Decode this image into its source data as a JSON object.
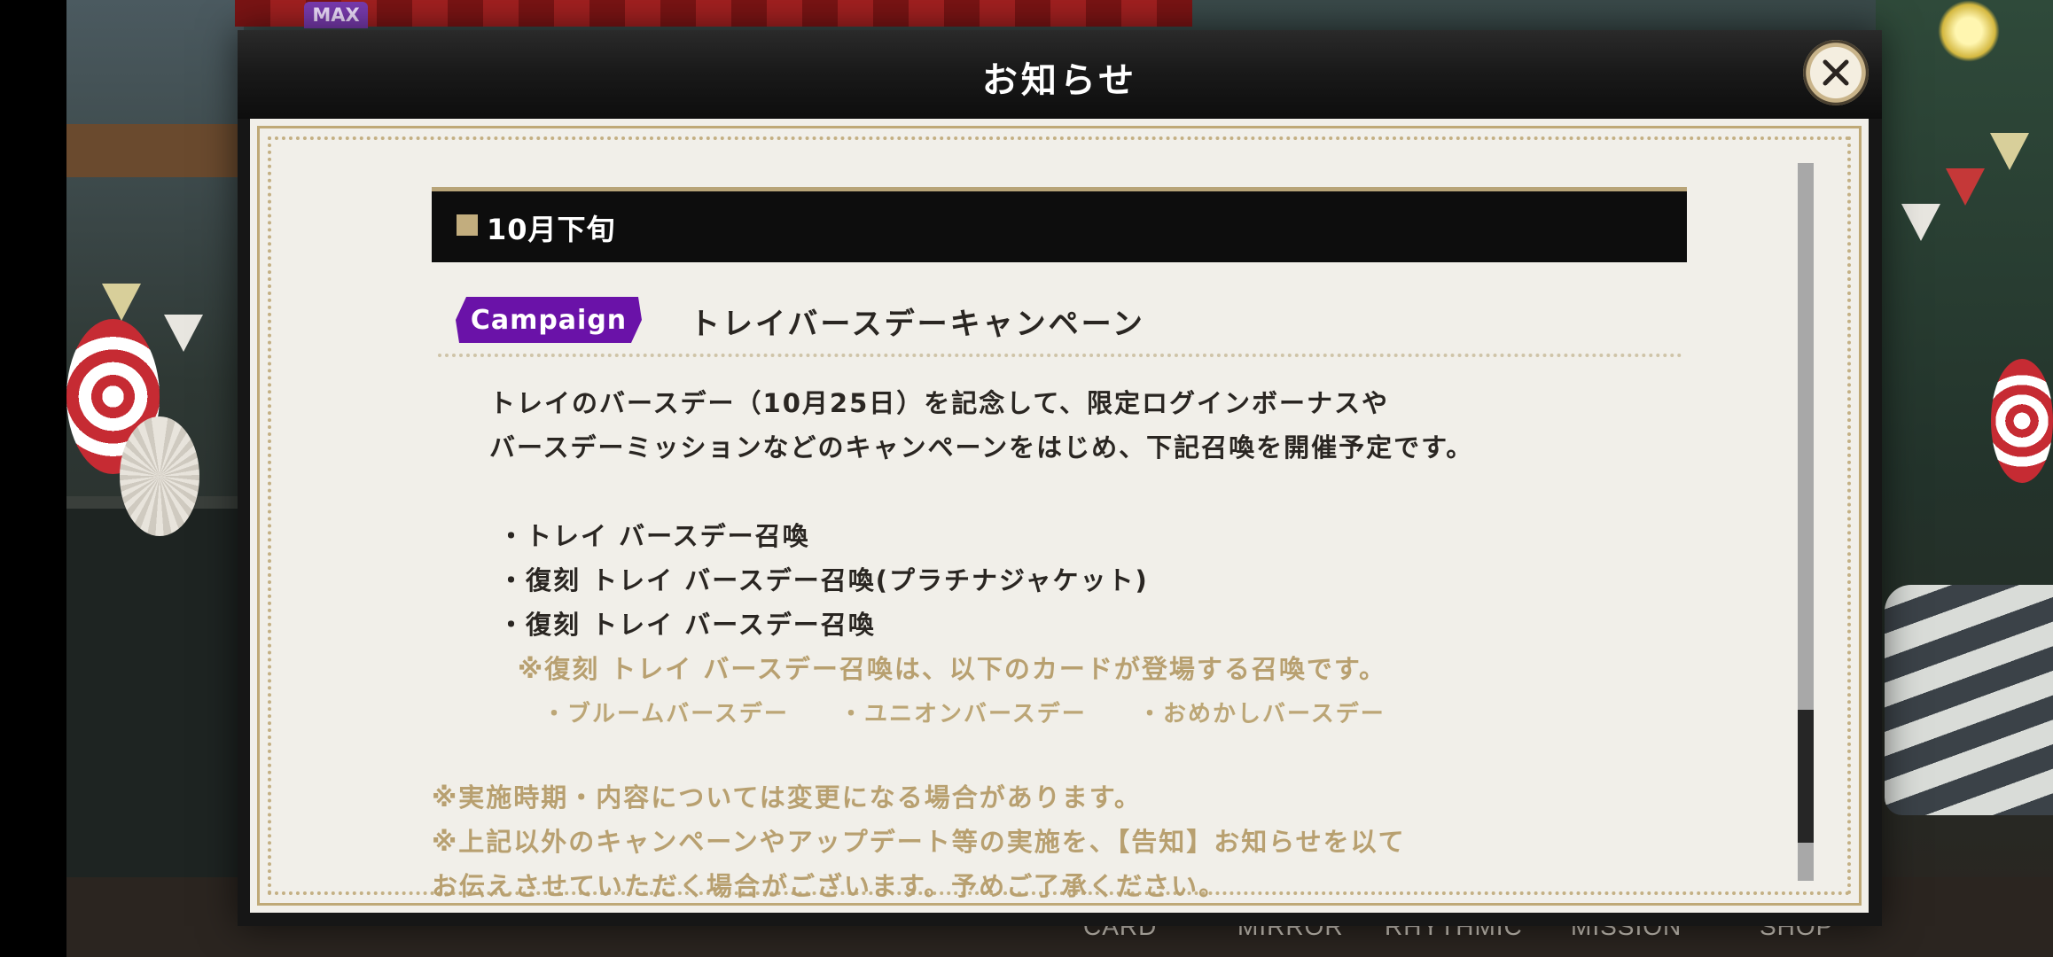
{
  "background": {
    "max_badge": "MAX",
    "nav": [
      "CARD",
      "MIRROR",
      "RHYTHMIC",
      "MISSION",
      "SHOP"
    ]
  },
  "dialog": {
    "title": "お知らせ",
    "close_icon": "close-icon",
    "section_title": "10月下旬",
    "badge": "Campaign",
    "item_title": "トレイバースデーキャンペーン",
    "paragraph": [
      "トレイのバースデー（10月25日）を記念して、限定ログインボーナスや",
      "バースデーミッションなどのキャンペーンをはじめ、下記召喚を開催予定です。"
    ],
    "bullets": [
      "・トレイ バースデー召喚",
      "・復刻 トレイ バースデー召喚(プラチナジャケット)",
      "・復刻 トレイ バースデー召喚"
    ],
    "note": "※復刻 トレイ バースデー召喚は、以下のカードが登場する召喚です。",
    "cards": [
      "・ブルームバースデー",
      "・ユニオンバースデー",
      "・おめかしバースデー"
    ],
    "footnotes": [
      "※実施時期・内容については変更になる場合があります。",
      "※上記以外のキャンペーンやアップデート等の実施を、【告知】お知らせを以て",
      "お伝えさせていただく場合がございます。予めご了承ください。"
    ],
    "colors": {
      "badge": "#6a12a8",
      "accent_gold": "#bfa977",
      "note": "#b8a070"
    },
    "scroll_position": 0.78
  }
}
